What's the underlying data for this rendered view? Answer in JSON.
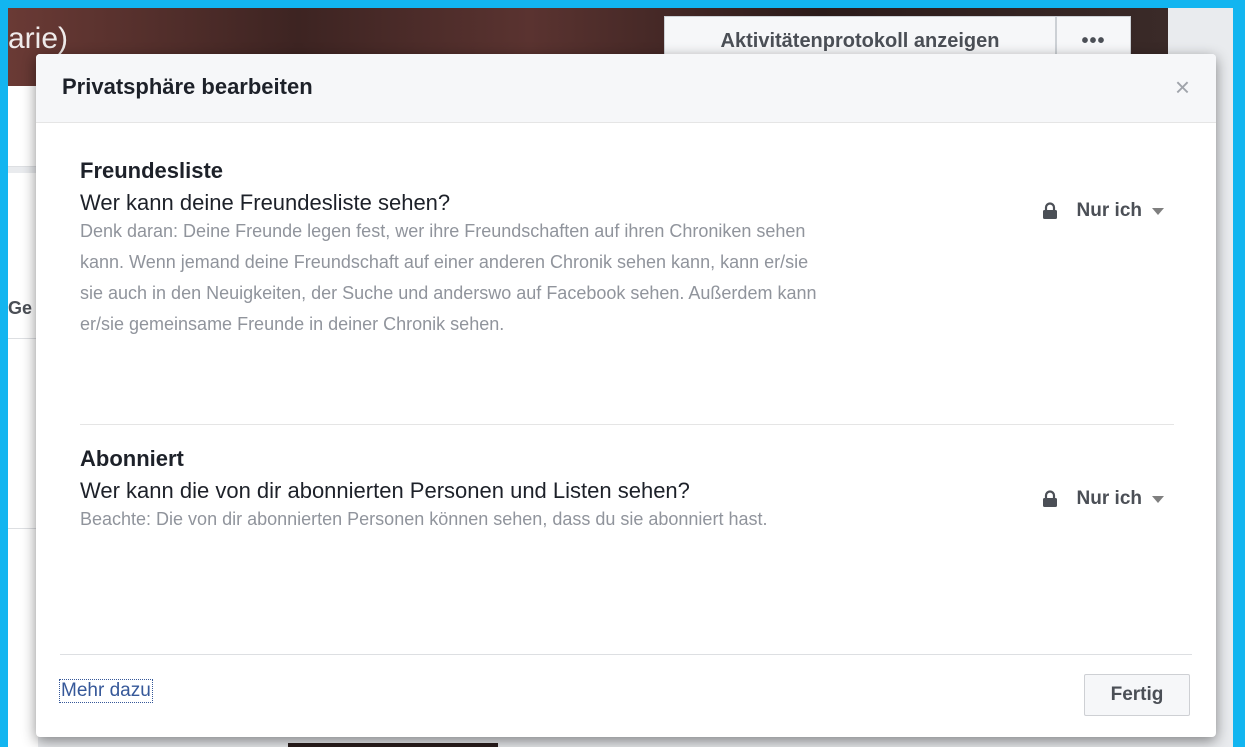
{
  "background": {
    "profile_name_fragment": "arie)",
    "activity_log_button": "Aktivitätenprotokoll anzeigen",
    "more_button": "•••",
    "sidebar_fragment": "Ge"
  },
  "dialog": {
    "title": "Privatsphäre bearbeiten",
    "close_icon": "×",
    "sections": [
      {
        "title": "Freundesliste",
        "question": "Wer kann deine Freundesliste sehen?",
        "note": "Denk daran: Deine Freunde legen fest, wer ihre Freundschaften auf ihren Chroniken sehen kann. Wenn jemand deine Freundschaft auf einer anderen Chronik sehen kann, kann er/sie sie auch in den Neuigkeiten, der Suche und anderswo auf Facebook sehen. Außerdem kann er/sie gemeinsame Freunde in deiner Chronik sehen.",
        "privacy_value": "Nur ich"
      },
      {
        "title": "Abonniert",
        "question": "Wer kann die von dir abonnierten Personen und Listen sehen?",
        "note": "Beachte: Die von dir abonnierten Personen können sehen, dass du sie abonniert hast.",
        "privacy_value": "Nur ich"
      }
    ],
    "footer": {
      "learn_more_link": "Mehr dazu",
      "done_button": "Fertig"
    }
  },
  "colors": {
    "frame": "#12b5f0",
    "link": "#365899",
    "secondary_text": "#90949c"
  },
  "icons": [
    "lock-icon",
    "chevron-down-icon",
    "close-icon"
  ]
}
